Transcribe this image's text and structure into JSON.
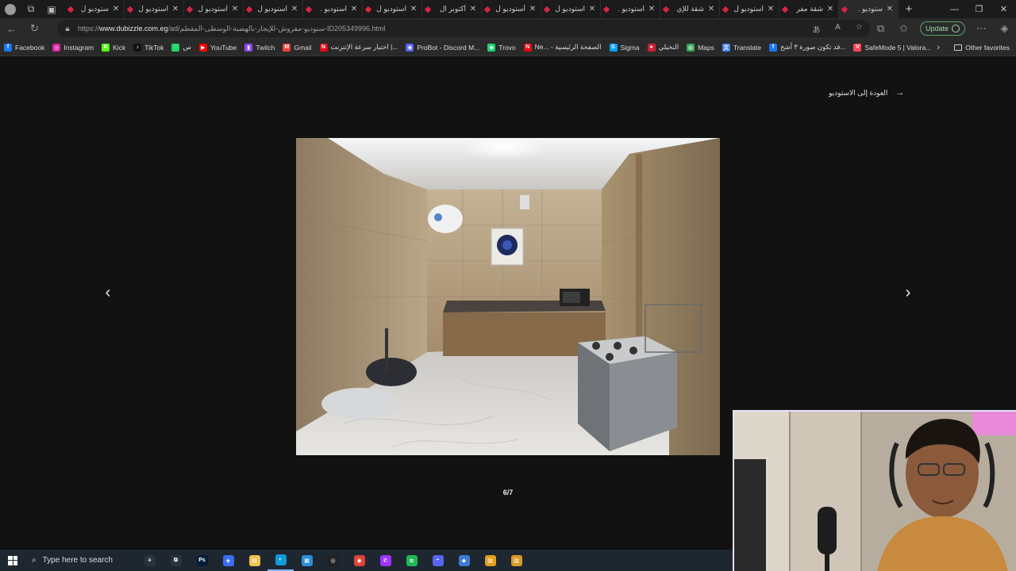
{
  "browser": {
    "tabs": [
      {
        "title": "ستوديو ل"
      },
      {
        "title": "استوديو ل"
      },
      {
        "title": "استوديو ل"
      },
      {
        "title": "استوديو ل"
      },
      {
        "title": "استوديو ."
      },
      {
        "title": "استوديو ل"
      },
      {
        "title": "أكتوبر ال"
      },
      {
        "title": "أستوديو ل"
      },
      {
        "title": "استوديو ل"
      },
      {
        "title": "استوديو ."
      },
      {
        "title": "شقة للإي"
      },
      {
        "title": "استوديو ل"
      },
      {
        "title": "شقة مفر"
      },
      {
        "title": "ستوديو ."
      }
    ],
    "url_prefix": "https://",
    "url_host": "www.dubizzle.com.eg",
    "url_path": "/ad/ستوديو-مفروش-للإيجار-بالهضبة-الوسطى-المقطم-ID205349996.html",
    "update_label": "Update",
    "bookmarks": [
      {
        "label": "Facebook",
        "icon": "facebook-icon",
        "color": "#1877f2",
        "glyph": "f"
      },
      {
        "label": "Instagram",
        "icon": "instagram-icon",
        "color": "#d6249f",
        "glyph": "◎"
      },
      {
        "label": "Kick",
        "icon": "kick-icon",
        "color": "#53fc18",
        "glyph": "K"
      },
      {
        "label": "TikTok",
        "icon": "tiktok-icon",
        "color": "#111111",
        "glyph": "♪"
      },
      {
        "label": "س",
        "icon": "whatsapp-icon",
        "color": "#25d366",
        "glyph": "◌"
      },
      {
        "label": "YouTube",
        "icon": "youtube-icon",
        "color": "#ff0000",
        "glyph": "▶"
      },
      {
        "label": "Twitch",
        "icon": "twitch-icon",
        "color": "#9146ff",
        "glyph": "▮"
      },
      {
        "label": "Gmail",
        "icon": "gmail-icon",
        "color": "#ea4335",
        "glyph": "M"
      },
      {
        "label": "اختبار سرعة الإنترنت |...",
        "icon": "speedtest-icon",
        "color": "#e50914",
        "glyph": "N"
      },
      {
        "label": "ProBot - Discord M...",
        "icon": "probot-icon",
        "color": "#5865f2",
        "glyph": "◉"
      },
      {
        "label": "Trovo",
        "icon": "trovo-icon",
        "color": "#19d66b",
        "glyph": "◆"
      },
      {
        "label": "Ne... - الصفحة الرئيسية",
        "icon": "netflix-icon",
        "color": "#e50914",
        "glyph": "N"
      },
      {
        "label": "Sigma",
        "icon": "sigma-icon",
        "color": "#00a2ff",
        "glyph": "S"
      },
      {
        "label": "النخيلي",
        "icon": "site-icon",
        "color": "#cc2233",
        "glyph": "●"
      },
      {
        "label": "Maps",
        "icon": "maps-icon",
        "color": "#34a853",
        "glyph": "◍"
      },
      {
        "label": "Translate",
        "icon": "translate-icon",
        "color": "#4285f4",
        "glyph": "文"
      },
      {
        "label": "قد تكون صورة ٣ أشخ...",
        "icon": "facebook-icon",
        "color": "#1877f2",
        "glyph": "f"
      },
      {
        "label": "SafeMode 5 | Valora...",
        "icon": "valorant-icon",
        "color": "#ff4655",
        "glyph": "V"
      }
    ],
    "other_favorites": "Other favorites"
  },
  "viewer": {
    "back_label": "العودة إلى الاستوديو",
    "counter": "6/7"
  },
  "taskbar": {
    "search_placeholder": "Type here to search",
    "apps": [
      {
        "name": "figures-icon",
        "glyph": "⚘",
        "color": "#2a3340"
      },
      {
        "name": "task-view-icon",
        "glyph": "⧉",
        "color": "#2a3340"
      },
      {
        "name": "photoshop-icon",
        "glyph": "Ps",
        "color": "#001e36"
      },
      {
        "name": "copilot-icon",
        "glyph": "◈",
        "color": "#3a6df0"
      },
      {
        "name": "file-explorer-icon",
        "glyph": "▤",
        "color": "#f2c14e"
      },
      {
        "name": "edge-icon",
        "glyph": "◐",
        "color": "#0f9bd7"
      },
      {
        "name": "store-icon",
        "glyph": "▦",
        "color": "#2b8fd6"
      },
      {
        "name": "obs-icon",
        "glyph": "◎",
        "color": "#222"
      },
      {
        "name": "chrome-icon",
        "glyph": "◉",
        "color": "#db4437"
      },
      {
        "name": "messenger-icon",
        "glyph": "✆",
        "color": "#a033ff"
      },
      {
        "name": "spotify-icon",
        "glyph": "≋",
        "color": "#1db954"
      },
      {
        "name": "discord-icon",
        "glyph": "◓",
        "color": "#5865f2"
      },
      {
        "name": "app-icon",
        "glyph": "◆",
        "color": "#3d7bd6"
      },
      {
        "name": "chart-app-icon",
        "glyph": "▥",
        "color": "#e0a020"
      },
      {
        "name": "paint-icon",
        "glyph": "▧",
        "color": "#d99b27"
      }
    ]
  },
  "colors": {
    "page_bg": "#121212",
    "tab_favicon": "#d7263d",
    "update_green": "#9bd5a8"
  }
}
